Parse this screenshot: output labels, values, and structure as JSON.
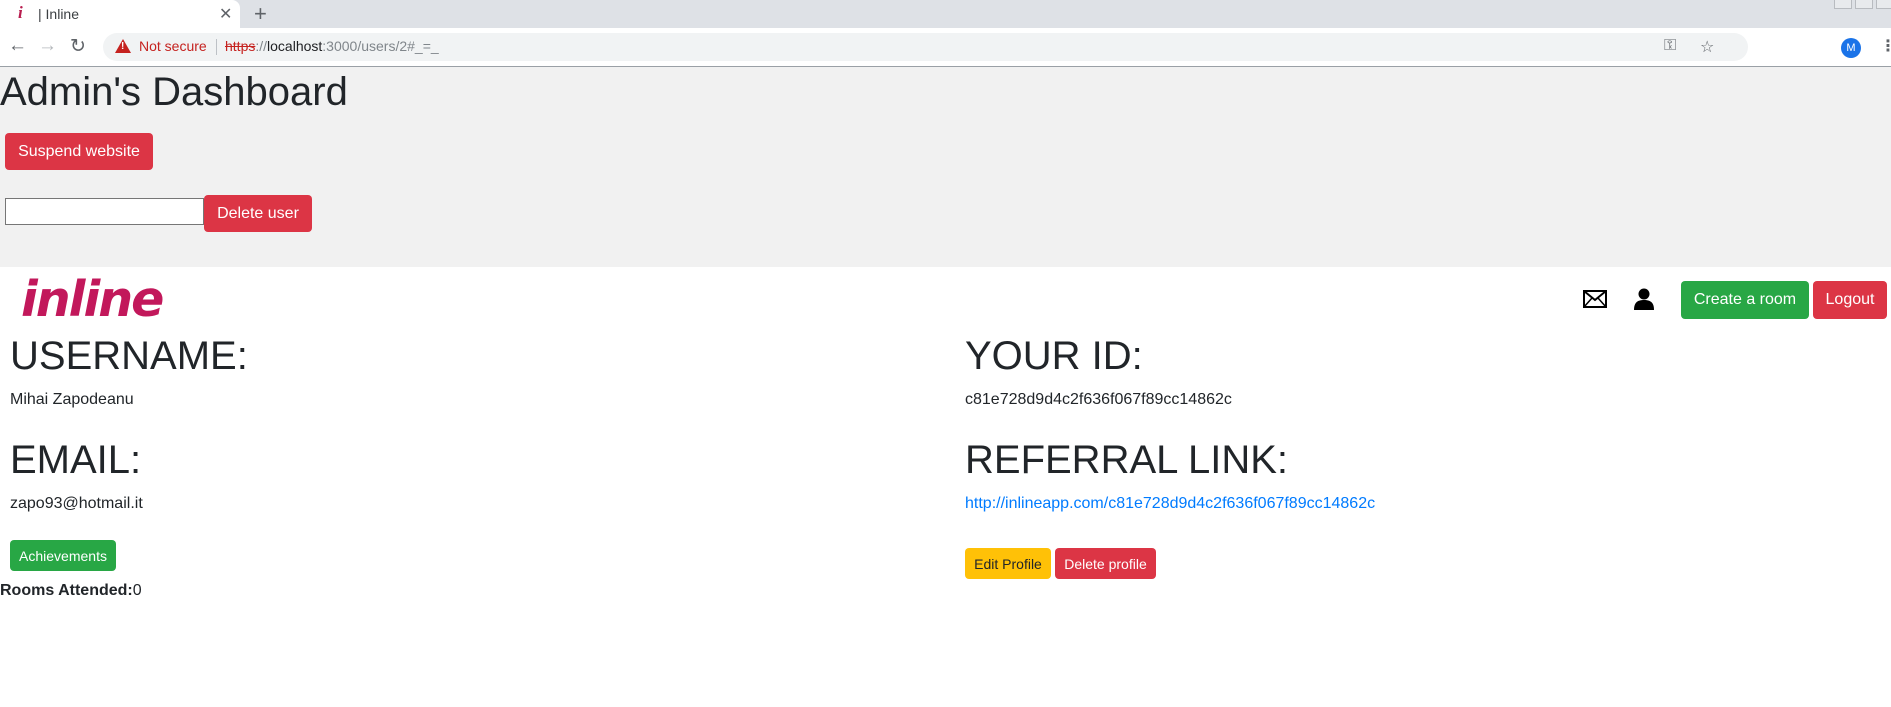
{
  "browser": {
    "tab_favicon": "i",
    "tab_title": "| Inline",
    "tab_close": "✕",
    "new_tab": "+",
    "back": "←",
    "forward": "→",
    "reload": "↻",
    "security_label": "Not secure",
    "url_scheme": "https",
    "url_sep": "://",
    "url_host": "localhost",
    "url_path": ":3000/users/2#_=_",
    "key_icon": "⚿",
    "star_icon": "☆",
    "profile_initial": "M",
    "menu": "⋮"
  },
  "admin": {
    "title": "Admin's Dashboard",
    "suspend_label": "Suspend website",
    "delete_input_value": "",
    "delete_user_label": "Delete user"
  },
  "header": {
    "logo_text": "inline",
    "create_room_label": "Create a room",
    "logout_label": "Logout"
  },
  "profile": {
    "username_label": "USERNAME:",
    "username": "Mihai Zapodeanu",
    "email_label": "EMAIL:",
    "email": "zapo93@hotmail.it",
    "achievements_label": "Achievements",
    "rooms_label": "Rooms Attended:",
    "rooms_value": "0",
    "id_label": "YOUR ID:",
    "id_value": "c81e728d9d4c2f636f067f89cc14862c",
    "referral_label": "REFERRAL LINK:",
    "referral_link": "http://inlineapp.com/c81e728d9d4c2f636f067f89cc14862c",
    "edit_label": "Edit Profile",
    "delete_profile_label": "Delete profile"
  },
  "colors": {
    "danger": "#dc3545",
    "success": "#28a745",
    "warning": "#ffc107",
    "link": "#007bff",
    "logo": "#c2185b"
  }
}
